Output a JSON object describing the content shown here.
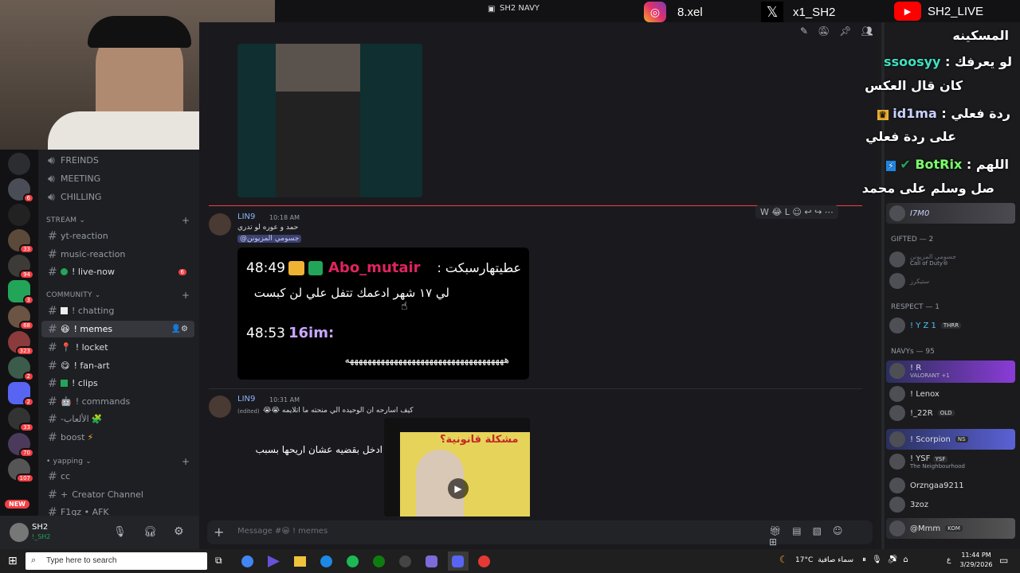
{
  "topbar": {
    "title": "SH2 NAVY"
  },
  "socials": {
    "instagram": "8.xel",
    "x": "x1_SH2",
    "youtube": "SH2_LIVE"
  },
  "servers": {
    "badges": [
      "6",
      "33",
      "94",
      "3",
      "68",
      "323",
      "2",
      "2",
      "33",
      "70",
      "107",
      "NEW"
    ]
  },
  "channels": {
    "voice": [
      "FREINDS",
      "MEETING",
      "CHILLING"
    ],
    "stream_category": "STREAM",
    "stream": [
      {
        "name": "yt-reaction"
      },
      {
        "name": "music-reaction"
      },
      {
        "name": "! live-now",
        "badge": "6"
      }
    ],
    "community_category": "COMMUNITY",
    "community": [
      {
        "name": "! chatting"
      },
      {
        "name": "! memes",
        "active": true
      },
      {
        "name": "! locket"
      },
      {
        "name": "! fan-art"
      },
      {
        "name": "! clips"
      },
      {
        "name": "! commands"
      },
      {
        "name": "-الألعاب"
      },
      {
        "name": "boost"
      }
    ],
    "yapping_category": "yapping",
    "yapping": [
      {
        "name": "cc"
      },
      {
        "name": "Creator Channel"
      },
      {
        "name": "F1gz • AFK"
      }
    ]
  },
  "user": {
    "name": "SH2",
    "status": "!_SH2"
  },
  "messages": [
    {
      "author": "LIN9",
      "time": "10:18 AM",
      "text": "حمد و عوره لو تدري",
      "mention": "@جسومي المزيونن",
      "embed": {
        "line1_time": "48:49",
        "line1_user": "Abo_mutair",
        "line1_text": "عطيتهارسبكت :",
        "line2": "لي ١٧ شهر ادعمك تتفل علي لن كبست",
        "line3_time": "48:53",
        "line3_user": "16im:",
        "line4": "ههههههههههههههههههههههههههههههههههههه"
      }
    },
    {
      "author": "LIN9",
      "time": "10:31 AM",
      "text": "كيف اسارحه ان الوحيده الي منحته ما اتلايمه 😭😭",
      "edited": "(edited)",
      "video_caption": "ادخل بقضيه عشان اريحها بسبب",
      "video_title": "مشكلة قانونية؟"
    }
  ],
  "composer": {
    "placeholder": "Message #😀 ! memes"
  },
  "chat_overlay": [
    {
      "user": "",
      "text": "المسكينه"
    },
    {
      "user": "ssoosyy",
      "text": "لو يعرفك :"
    },
    {
      "user": "",
      "text": "كان قال العكس"
    },
    {
      "user": "id1ma",
      "text": "ردة فعلي :"
    },
    {
      "user": "",
      "text": "على ردة فعلي"
    },
    {
      "user": "BotRix",
      "text": "اللهم :"
    },
    {
      "user": "",
      "text": "صل وسلم على محمد"
    }
  ],
  "members": {
    "top": "I7M0",
    "gifted_header": "GIFTED — 2",
    "gifted": [
      {
        "name": "جسومي المزيونن",
        "sub": "Call of Duty®"
      },
      {
        "name": "ستيكرز",
        "sub": ""
      }
    ],
    "respect_header": "RESPECT — 1",
    "respect": [
      {
        "name": "! Y Z 1",
        "tag": "THRR"
      }
    ],
    "navys_header": "NAVYs — 95",
    "navys": [
      {
        "name": "! R",
        "sub": "VALORANT +1"
      },
      {
        "name": "! Lenox",
        "sub": ""
      },
      {
        "name": "!_22R",
        "tag": "OLD"
      },
      {
        "name": "! Scorpion",
        "tag": "NS"
      },
      {
        "name": "! YSF",
        "tag": "YSF",
        "sub": "The Neighbourhood"
      },
      {
        "name": "Orzngaa9211",
        "sub": ""
      },
      {
        "name": "3zoz",
        "sub": ""
      },
      {
        "name": "@Mmm",
        "tag": "KOM"
      }
    ]
  },
  "taskbar": {
    "search": "Type here to search",
    "weather": "17°C",
    "weather_text": "سماء صافية",
    "lang": "ع",
    "time": "11:44 PM",
    "date": "3/29/2026"
  },
  "colors": {
    "accent": "#5865f2",
    "danger": "#f23f43",
    "pink_user": "#e0245e",
    "purple_user": "#c9a7ff"
  }
}
